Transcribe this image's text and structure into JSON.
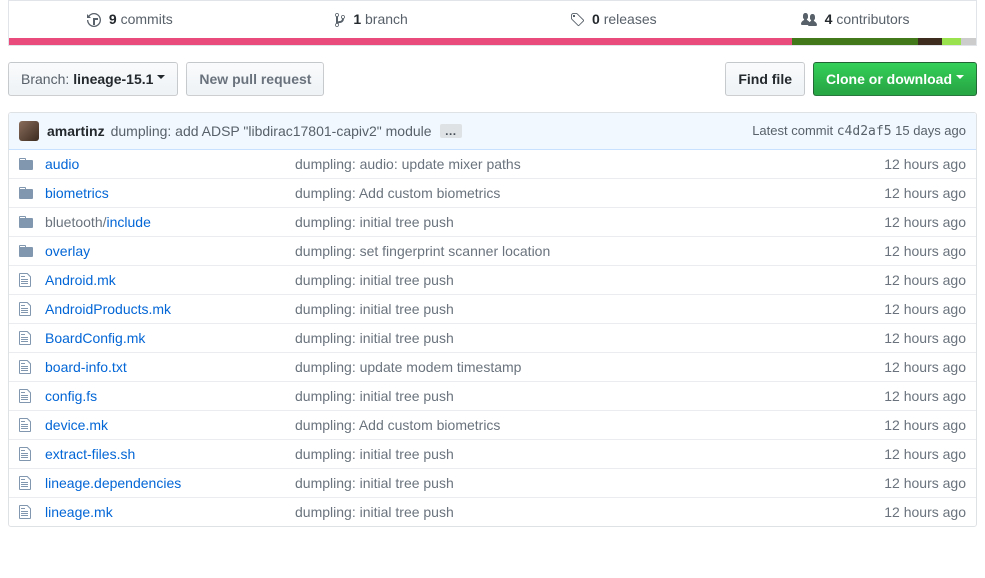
{
  "stats": {
    "commits": {
      "count": "9",
      "label": "commits"
    },
    "branches": {
      "count": "1",
      "label": "branch"
    },
    "releases": {
      "count": "0",
      "label": "releases"
    },
    "contributors": {
      "count": "4",
      "label": "contributors"
    }
  },
  "toolbar": {
    "branch_prefix": "Branch:",
    "branch_name": "lineage-15.1",
    "new_pr": "New pull request",
    "find_file": "Find file",
    "clone": "Clone or download"
  },
  "latest": {
    "author": "amartinz",
    "message": "dumpling: add ADSP \"libdirac17801-capiv2\" module",
    "prefix": "Latest commit",
    "sha": "c4d2af5",
    "time": "15 days ago"
  },
  "files": [
    {
      "type": "dir",
      "name": "audio",
      "msg": "dumpling: audio: update mixer paths",
      "time": "12 hours ago"
    },
    {
      "type": "dir",
      "name": "biometrics",
      "msg": "dumpling: Add custom biometrics",
      "time": "12 hours ago"
    },
    {
      "type": "dir",
      "prefix": "bluetooth/",
      "name": "include",
      "msg": "dumpling: initial tree push",
      "time": "12 hours ago"
    },
    {
      "type": "dir",
      "name": "overlay",
      "msg": "dumpling: set fingerprint scanner location",
      "time": "12 hours ago"
    },
    {
      "type": "file",
      "name": "Android.mk",
      "msg": "dumpling: initial tree push",
      "time": "12 hours ago"
    },
    {
      "type": "file",
      "name": "AndroidProducts.mk",
      "msg": "dumpling: initial tree push",
      "time": "12 hours ago"
    },
    {
      "type": "file",
      "name": "BoardConfig.mk",
      "msg": "dumpling: initial tree push",
      "time": "12 hours ago"
    },
    {
      "type": "file",
      "name": "board-info.txt",
      "msg": "dumpling: update modem timestamp",
      "time": "12 hours ago"
    },
    {
      "type": "file",
      "name": "config.fs",
      "msg": "dumpling: initial tree push",
      "time": "12 hours ago"
    },
    {
      "type": "file",
      "name": "device.mk",
      "msg": "dumpling: Add custom biometrics",
      "time": "12 hours ago"
    },
    {
      "type": "file",
      "name": "extract-files.sh",
      "msg": "dumpling: initial tree push",
      "time": "12 hours ago"
    },
    {
      "type": "file",
      "name": "lineage.dependencies",
      "msg": "dumpling: initial tree push",
      "time": "12 hours ago"
    },
    {
      "type": "file",
      "name": "lineage.mk",
      "msg": "dumpling: initial tree push",
      "time": "12 hours ago"
    }
  ]
}
